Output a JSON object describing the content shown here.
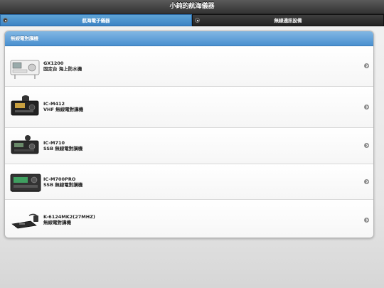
{
  "header": {
    "title": "小鈍的航海儀器"
  },
  "navbar": {
    "tabs": [
      {
        "label": "航海電子儀器",
        "icon": "menu-icon",
        "active": true
      },
      {
        "label": "無線通訊設備",
        "icon": "menu-icon",
        "active": false
      }
    ]
  },
  "list": {
    "divider": "無線電對講機",
    "items": [
      {
        "model": "GX1200",
        "desc": "固定台 海上防水機",
        "icon": "radio-image"
      },
      {
        "model": "IC-M412",
        "desc": "VHF 無線電對講機",
        "icon": "radio-image"
      },
      {
        "model": "IC-M710",
        "desc": "SSB 無線電對講機",
        "icon": "radio-image"
      },
      {
        "model": "IC-M700PRO",
        "desc": "SSB 無線電對講機",
        "icon": "radio-image"
      },
      {
        "model": "K-6124MK2(27MHZ)",
        "desc": "無線電對講機",
        "icon": "radio-image"
      }
    ]
  },
  "colors": {
    "accent": "#4a90cf",
    "header": "#3a3a3a"
  }
}
